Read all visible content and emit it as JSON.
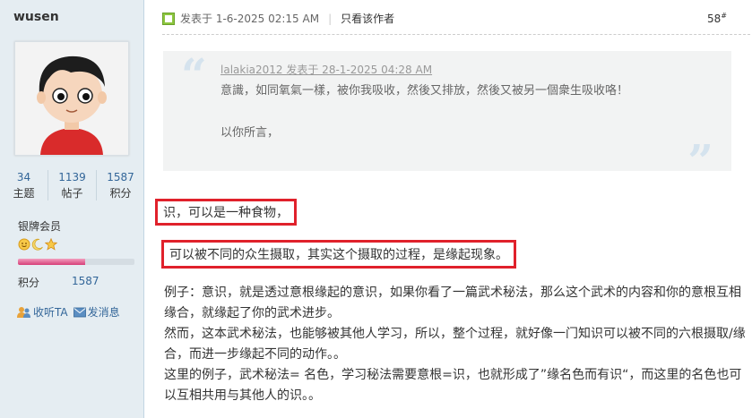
{
  "user": {
    "name": "wusen",
    "stats": [
      {
        "value": "34",
        "label": "主题"
      },
      {
        "value": "1139",
        "label": "帖子"
      },
      {
        "value": "1587",
        "label": "积分"
      }
    ],
    "rank": "银牌会员",
    "medals": [
      "sun-icon",
      "moon-icon",
      "star-icon"
    ],
    "progress_fraction": 0.58,
    "points_label": "积分",
    "points_value": "1587",
    "follow_label": "收听TA",
    "message_label": "发消息"
  },
  "post": {
    "posted_at": "发表于 1-6-2025 02:15 AM",
    "author_only": "只看该作者",
    "floor": "58",
    "floor_mark": "#",
    "quote": {
      "header": "lalakia2012 发表于 28-1-2025 04:28 AM",
      "line1": "意識，如同氧氣一樣，被你我吸收，然後又排放，然後又被另一個衆生吸收咯！",
      "line2": "以你所言，"
    },
    "highlight1": "识，可以是一种食物，",
    "highlight2": "可以被不同的众生摄取，其实这个摄取的过程，是缘起现象。",
    "paragraphs": [
      "例子：意识，就是透过意根缘起的意识，如果你看了一篇武术秘法，那么这个武术的内容和你的意根互相缘合，就缘起了你的武术进步。",
      "然而，这本武术秘法，也能够被其他人学习，所以，整个过程，就好像一门知识可以被不同的六根摄取/缘合，而进一步缘起不同的动作。。",
      "这里的例子，武术秘法= 名色，学习秘法需要意根=识，也就形成了”缘名色而有识“，而这里的名色也可以互相共用与其他人的识。。"
    ]
  },
  "colors": {
    "sidebar_bg": "#e5edf2",
    "link": "#336699",
    "highlight_border": "#e0212b",
    "quote_bg": "#f2f3f3"
  }
}
